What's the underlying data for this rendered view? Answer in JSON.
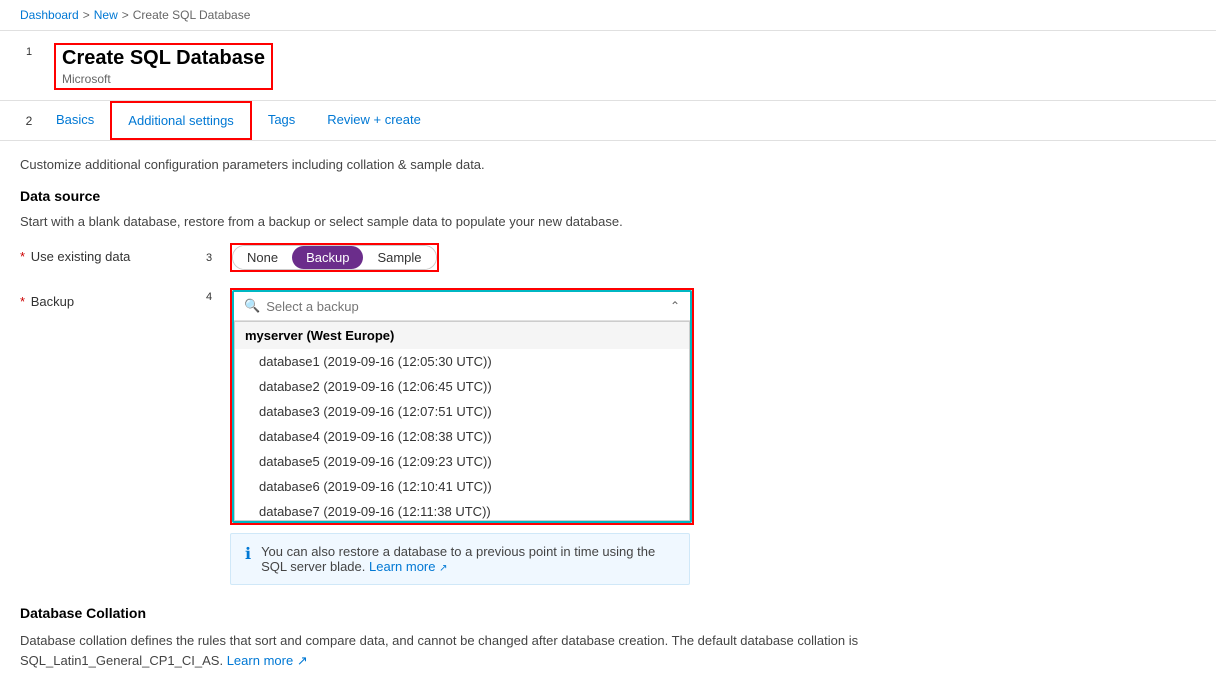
{
  "breadcrumb": {
    "items": [
      "Dashboard",
      "New",
      "Create SQL Database"
    ],
    "separators": [
      ">",
      ">"
    ]
  },
  "page": {
    "number": "1",
    "title": "Create SQL Database",
    "subtitle": "Microsoft"
  },
  "tabs": {
    "number": "2",
    "items": [
      {
        "id": "basics",
        "label": "Basics",
        "active": false
      },
      {
        "id": "additional",
        "label": "Additional settings",
        "active": true
      },
      {
        "id": "tags",
        "label": "Tags",
        "active": false
      },
      {
        "id": "review",
        "label": "Review + create",
        "active": false
      }
    ]
  },
  "content": {
    "description": "Customize additional configuration parameters including collation & sample data.",
    "datasource": {
      "title": "Data source",
      "description": "Start with a blank database, restore from a backup or select sample data to populate your new database."
    },
    "useExistingData": {
      "label": "Use existing data",
      "required": true,
      "number": "3",
      "options": [
        "None",
        "Backup",
        "Sample"
      ],
      "selected": "Backup"
    },
    "backup": {
      "label": "Backup",
      "required": true,
      "number": "4",
      "placeholder": "Select a backup",
      "server": "myserver (West Europe)",
      "items": [
        "database1 (2019-09-16 (12:05:30 UTC))",
        "database2 (2019-09-16 (12:06:45 UTC))",
        "database3 (2019-09-16 (12:07:51 UTC))",
        "database4 (2019-09-16 (12:08:38 UTC))",
        "database5 (2019-09-16 (12:09:23 UTC))",
        "database6 (2019-09-16 (12:10:41 UTC))",
        "database7 (2019-09-16 (12:11:38 UTC))"
      ]
    },
    "infoBox": {
      "text": "You can also restore a database to a previous point in time using the SQL server blade.",
      "linkText": "Learn more",
      "linkIcon": "↗"
    },
    "collation": {
      "title": "Database Collation",
      "description": "Database collation defines the rules that sort and compare data, and cannot be changed after database creation. The default database collation is SQL_Latin1_General_CP1_CI_AS.",
      "linkText": "Learn more",
      "linkIcon": "↗"
    }
  }
}
